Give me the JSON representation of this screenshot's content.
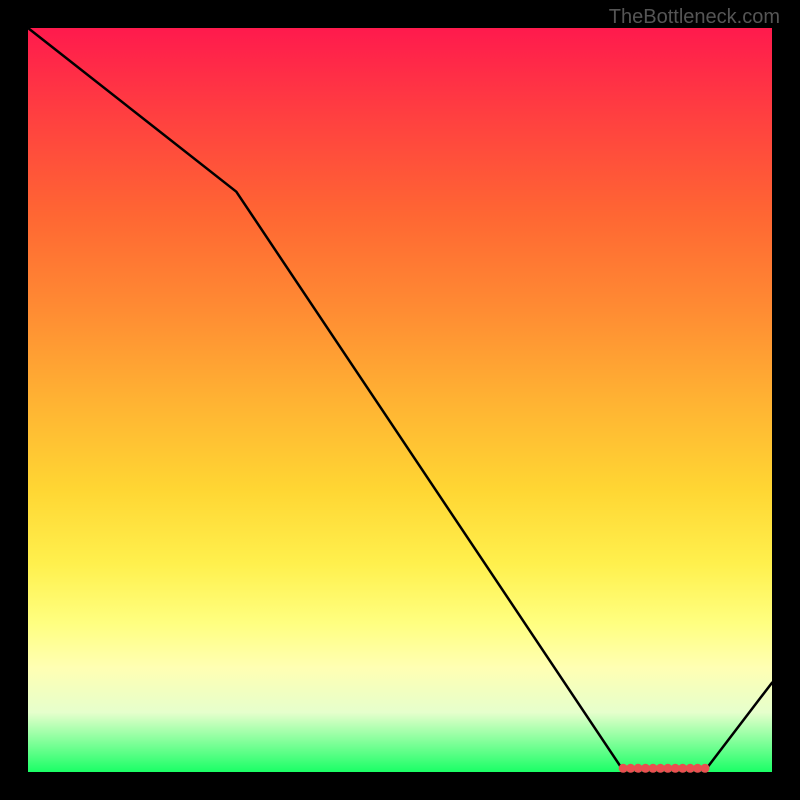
{
  "watermark": "TheBottleneck.com",
  "chart_data": {
    "type": "line",
    "title": "",
    "xlabel": "",
    "ylabel": "",
    "xlim": [
      0,
      100
    ],
    "ylim": [
      0,
      100
    ],
    "x": [
      0,
      28,
      80,
      83,
      85,
      87,
      89,
      91,
      100
    ],
    "y": [
      100,
      78,
      0.2,
      0.2,
      0.2,
      0.2,
      0.2,
      0.2,
      12
    ],
    "marker_points": {
      "x": [
        80,
        81,
        82,
        83,
        84,
        85,
        86,
        87,
        88,
        89,
        90,
        91
      ],
      "y": [
        0.5,
        0.5,
        0.5,
        0.5,
        0.5,
        0.5,
        0.5,
        0.5,
        0.5,
        0.5,
        0.5,
        0.5
      ]
    },
    "line_color": "#000000",
    "marker_color": "#e85050"
  }
}
